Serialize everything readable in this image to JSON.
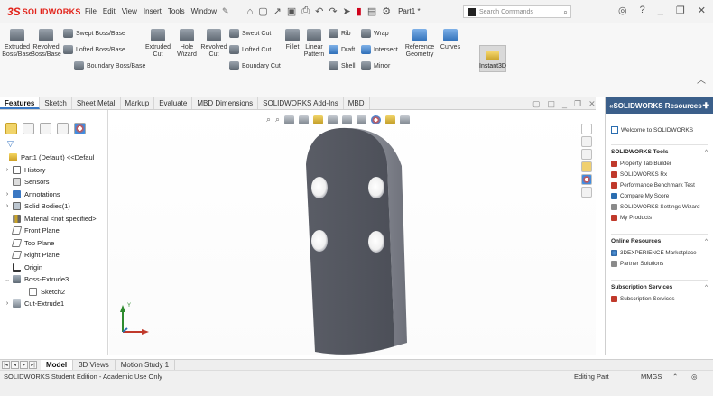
{
  "app": {
    "logo_ds": "3S",
    "logo_name": "SOLIDWORKS",
    "menus": [
      "File",
      "Edit",
      "View",
      "Insert",
      "Tools",
      "Window"
    ],
    "part_title": "Part1 *",
    "search_placeholder": "Search Commands"
  },
  "ribbon": {
    "extruded_boss": "Extruded Boss/Base",
    "revolved_boss": "Revolved Boss/Base",
    "swept_boss": "Swept Boss/Base",
    "lofted_boss": "Lofted Boss/Base",
    "boundary_boss": "Boundary Boss/Base",
    "extruded_cut": "Extruded Cut",
    "hole_wizard": "Hole Wizard",
    "revolved_cut": "Revolved Cut",
    "swept_cut": "Swept Cut",
    "lofted_cut": "Lofted Cut",
    "boundary_cut": "Boundary Cut",
    "fillet": "Fillet",
    "linear_pattern": "Linear Pattern",
    "rib": "Rib",
    "draft": "Draft",
    "shell": "Shell",
    "wrap": "Wrap",
    "intersect": "Intersect",
    "mirror": "Mirror",
    "reference_geometry": "Reference Geometry",
    "curves": "Curves",
    "instant3d": "Instant3D"
  },
  "tabs": [
    "Features",
    "Sketch",
    "Sheet Metal",
    "Markup",
    "Evaluate",
    "MBD Dimensions",
    "SOLIDWORKS Add-Ins",
    "MBD"
  ],
  "active_tab": "Features",
  "tree": [
    {
      "label": "Part1 (Default) <<Defaul",
      "icon": "part-icon",
      "arrow": ""
    },
    {
      "label": "History",
      "icon": "history-icon",
      "arrow": "›"
    },
    {
      "label": "Sensors",
      "icon": "sensor-icon",
      "arrow": ""
    },
    {
      "label": "Annotations",
      "icon": "annotation-icon",
      "arrow": "›"
    },
    {
      "label": "Solid Bodies(1)",
      "icon": "solid-bodies-icon",
      "arrow": "›"
    },
    {
      "label": "Material <not specified>",
      "icon": "material-icon",
      "arrow": ""
    },
    {
      "label": "Front Plane",
      "icon": "plane-icon",
      "arrow": ""
    },
    {
      "label": "Top Plane",
      "icon": "plane-icon",
      "arrow": ""
    },
    {
      "label": "Right Plane",
      "icon": "plane-icon",
      "arrow": ""
    },
    {
      "label": "Origin",
      "icon": "origin-icon",
      "arrow": ""
    },
    {
      "label": "Boss-Extrude3",
      "icon": "boss-extrude-icon",
      "arrow": "⌄"
    },
    {
      "label": "Sketch2",
      "icon": "sketch-icon",
      "arrow": ""
    },
    {
      "label": "Cut-Extrude1",
      "icon": "cut-extrude-icon",
      "arrow": "›"
    }
  ],
  "resources": {
    "header": "SOLIDWORKS Resources",
    "welcome": "Welcome to SOLIDWORKS",
    "tools_title": "SOLIDWORKS Tools",
    "tools": [
      "Property Tab Builder",
      "SOLIDWORKS Rx",
      "Performance Benchmark Test",
      "Compare My Score",
      "SOLIDWORKS Settings Wizard",
      "My Products"
    ],
    "online_title": "Online Resources",
    "online": [
      "3DEXPERIENCE Marketplace",
      "Partner Solutions"
    ],
    "subs_title": "Subscription Services",
    "subs": [
      "Subscription Services"
    ]
  },
  "bottom_tabs": [
    "Model",
    "3D Views",
    "Motion Study 1"
  ],
  "active_bottom_tab": "Model",
  "status": {
    "left": "SOLIDWORKS Student Edition - Academic Use Only",
    "editing": "Editing Part",
    "units": "MMGS"
  },
  "axis_labels": {
    "y": "Y"
  },
  "colors": {
    "brand": "#e2231a",
    "panel_header": "#3b5f8a",
    "part": "#5b5e66"
  }
}
